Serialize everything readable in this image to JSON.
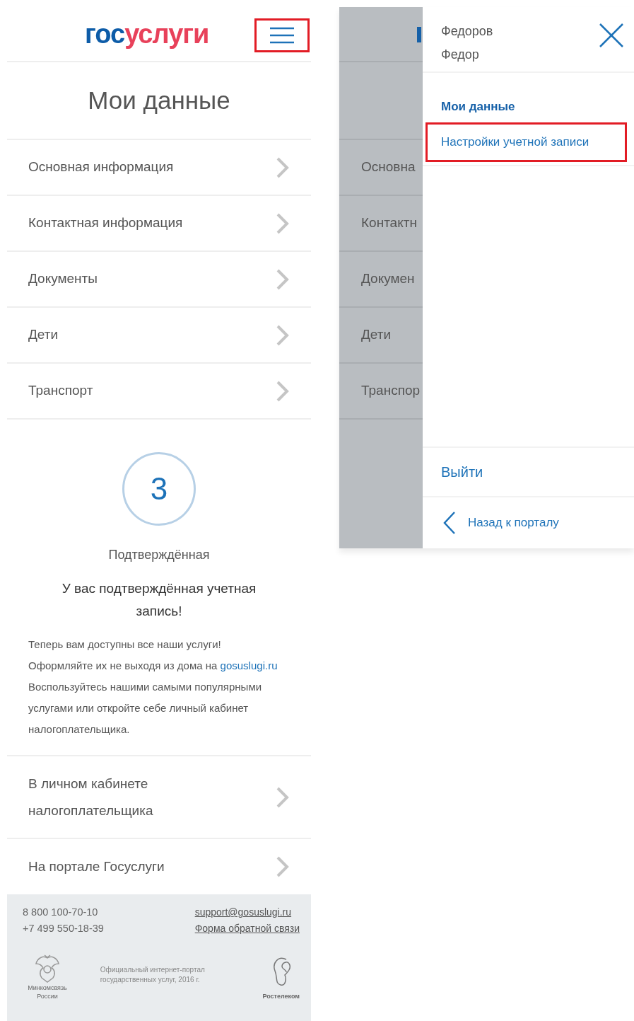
{
  "left": {
    "header": {
      "logo_part_1": "гос",
      "logo_part_2": "услуги",
      "menu_button": {
        "highlighted": true
      }
    },
    "title": "Мои данные",
    "sections": [
      {
        "label": "Основная информация"
      },
      {
        "label": "Контактная информация"
      },
      {
        "label": "Документы"
      },
      {
        "label": "Дети"
      },
      {
        "label": "Транспорт"
      }
    ],
    "status": {
      "level_number": "3",
      "level_name": "Подтверждённая",
      "heading": "У вас подтверждённая учетная запись!",
      "text_before_link": "Теперь вам доступны все наши услуги! Оформляйте их не выходя из дома на",
      "link": "gosuslugi.ru",
      "text_after_link": "Воспользуйтесь нашими самыми популярными услугами или откройте себе личный кабинет налогоплательщика."
    },
    "links": [
      {
        "label": "В личном кабинете налогоплательщика"
      },
      {
        "label": "На портале Госуслуги"
      }
    ],
    "footer": {
      "phones": [
        "8 800 100-70-10",
        "+7 499 550-18-39"
      ],
      "links": [
        "support@gosuslugi.ru",
        "Форма обратной связи"
      ],
      "ministry": "Минкомсвязь России",
      "copyright": "Официальный интернет-портал государственных услуг, 2016 г.",
      "operator": "Ростелеком"
    }
  },
  "right": {
    "background_page": {
      "sections": [
        "Основна",
        "Контактн",
        "Докумен",
        "Дети",
        "Транспор"
      ]
    },
    "drawer": {
      "user_name": [
        "Федоров",
        "Федор"
      ],
      "menu": [
        {
          "label": "Мои данные",
          "selected": true,
          "highlighted": false
        },
        {
          "label": "Настройки учетной записи",
          "selected": false,
          "highlighted": true
        }
      ],
      "logout": "Выйти",
      "back": "Назад к порталу"
    }
  }
}
